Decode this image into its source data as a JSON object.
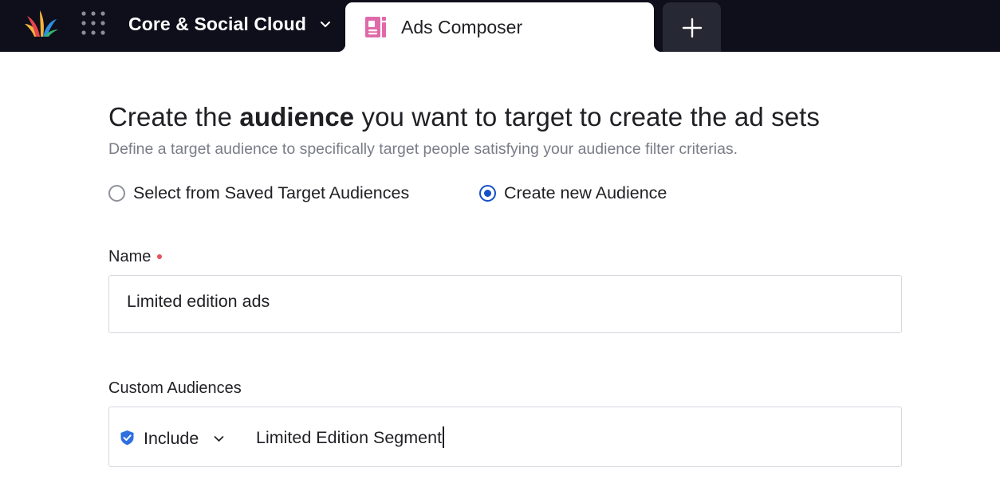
{
  "topbar": {
    "logo_icon": "sprinklr-logo-icon",
    "apps_icon": "grid-dots-icon",
    "cloud_switcher": {
      "label": "Core & Social Cloud",
      "icon": "chevron-down-icon"
    },
    "tabs": [
      {
        "label": "Ads Composer",
        "icon": "ads-composer-icon",
        "active": true
      }
    ],
    "add_tab_icon": "plus-icon"
  },
  "main": {
    "heading": {
      "pre": "Create the ",
      "bold": "audience",
      "post": " you want to target to create the ad sets"
    },
    "subheading": "Define a target audience to specifically target people satisfying your audience filter criterias.",
    "audience_mode": {
      "options": [
        {
          "label": "Select from Saved Target Audiences",
          "selected": false
        },
        {
          "label": "Create new Audience",
          "selected": true
        }
      ]
    },
    "name_field": {
      "label": "Name",
      "required": true,
      "value": "Limited edition ads"
    },
    "custom_audiences": {
      "label": "Custom Audiences",
      "mode_icon": "shield-check-icon",
      "mode": "Include",
      "mode_chevron_icon": "chevron-down-icon",
      "value": "Limited Edition Segment"
    }
  },
  "colors": {
    "topbar_bg": "#0e0f1a",
    "accent_blue": "#1450c8",
    "required_dot": "#e8505b",
    "muted_text": "#7a7d88"
  }
}
